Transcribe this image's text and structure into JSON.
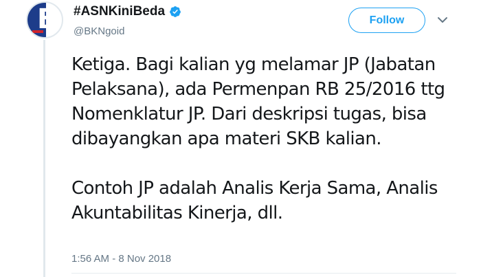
{
  "user": {
    "display_name": "#ASNKiniBeda",
    "handle": "@BKNgoid",
    "avatar_letter": "B",
    "verified": true
  },
  "follow_button": {
    "label": "Follow"
  },
  "menu": {
    "icon": "chevron-down-icon"
  },
  "tweet": {
    "paragraphs": [
      "Ketiga. Bagi kalian yg melamar JP (Jabatan Pelaksana), ada Permenpan RB 25/2016 ttg Nomenklatur JP. Dari deskripsi tugas, bisa dibayangkan apa materi SKB kalian.",
      "Contoh JP adalah Analis Kerja Sama, Analis Akuntabilitas Kinerja, dll."
    ],
    "timestamp": "1:56 AM - 8 Nov 2018"
  },
  "colors": {
    "accent": "#1da1f2",
    "text": "#14171a",
    "muted": "#657786",
    "avatar_blue": "#1d3c8a",
    "avatar_red": "#d0242c"
  }
}
